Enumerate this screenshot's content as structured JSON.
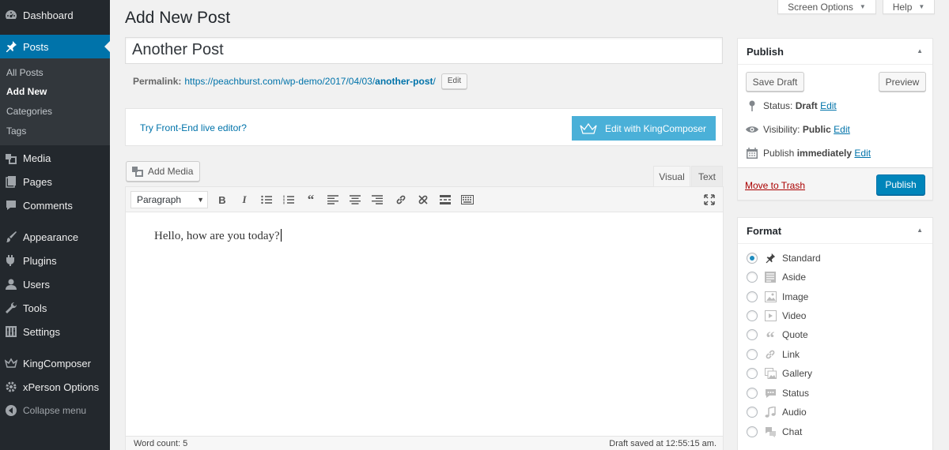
{
  "sidebar": {
    "dashboard": "Dashboard",
    "posts": "Posts",
    "submenu": [
      "All Posts",
      "Add New",
      "Categories",
      "Tags"
    ],
    "media": "Media",
    "pages": "Pages",
    "comments": "Comments",
    "appearance": "Appearance",
    "plugins": "Plugins",
    "users": "Users",
    "tools": "Tools",
    "settings": "Settings",
    "kingcomposer": "KingComposer",
    "xperson": "xPerson Options",
    "collapse": "Collapse menu"
  },
  "screen_meta": {
    "options": "Screen Options",
    "help": "Help"
  },
  "page": {
    "title": "Add New Post",
    "post_title": "Another Post",
    "permalink_label": "Permalink:",
    "permalink_base": "https://peachburst.com/wp-demo/2017/04/03/",
    "permalink_slug": "another-post",
    "permalink_tail": "/",
    "edit_label": "Edit"
  },
  "kc": {
    "link": "Try Front-End live editor?",
    "button": "Edit with KingComposer"
  },
  "editor": {
    "add_media": "Add Media",
    "tab_visual": "Visual",
    "tab_text": "Text",
    "format_select": "Paragraph",
    "content": "Hello, how are you today?",
    "word_count": "Word count: 5",
    "saved": "Draft saved at 12:55:15 am."
  },
  "publish": {
    "title": "Publish",
    "save_draft": "Save Draft",
    "preview": "Preview",
    "status_label": "Status:",
    "status_value": "Draft",
    "visibility_label": "Visibility:",
    "visibility_value": "Public",
    "publish_label": "Publish",
    "publish_value": "immediately",
    "edit": "Edit",
    "trash": "Move to Trash",
    "publish_button": "Publish"
  },
  "format": {
    "title": "Format",
    "selected": "Standard",
    "options": [
      "Standard",
      "Aside",
      "Image",
      "Video",
      "Quote",
      "Link",
      "Gallery",
      "Status",
      "Audio",
      "Chat"
    ]
  },
  "colors": {
    "sidebar": "#23282d",
    "accent": "#0073aa",
    "kc_button": "#4ab0d8",
    "publish_button": "#0085ba"
  }
}
